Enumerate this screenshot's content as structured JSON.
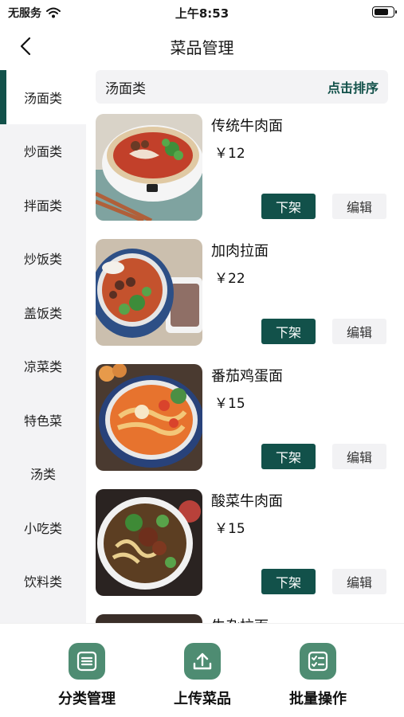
{
  "status_bar": {
    "carrier": "无服务",
    "time": "上午8:53",
    "battery_level": 0.8
  },
  "nav": {
    "title": "菜品管理"
  },
  "sidebar": {
    "items": [
      {
        "label": "汤面类",
        "active": true
      },
      {
        "label": "炒面类"
      },
      {
        "label": "拌面类"
      },
      {
        "label": "炒饭类"
      },
      {
        "label": "盖饭类"
      },
      {
        "label": "凉菜类"
      },
      {
        "label": "特色菜"
      },
      {
        "label": "汤类"
      },
      {
        "label": "小吃类"
      },
      {
        "label": "饮料类"
      }
    ]
  },
  "category": {
    "title": "汤面类",
    "sort_label": "点击排序"
  },
  "dishes": [
    {
      "name": "传统牛肉面",
      "price": "￥12",
      "off_label": "下架",
      "edit_label": "编辑"
    },
    {
      "name": "加肉拉面",
      "price": "￥22",
      "off_label": "下架",
      "edit_label": "编辑"
    },
    {
      "name": "番茄鸡蛋面",
      "price": "￥15",
      "off_label": "下架",
      "edit_label": "编辑"
    },
    {
      "name": "酸菜牛肉面",
      "price": "￥15",
      "off_label": "下架",
      "edit_label": "编辑"
    },
    {
      "name": "牛杂拉面",
      "price": "",
      "off_label": "",
      "edit_label": ""
    }
  ],
  "toolbar": {
    "category_label": "分类管理",
    "upload_label": "上传菜品",
    "batch_label": "批量操作"
  },
  "colors": {
    "accent": "#12514a",
    "toolbar_icon": "#4e8c72",
    "sidebar_bg": "#f3f3f5"
  }
}
